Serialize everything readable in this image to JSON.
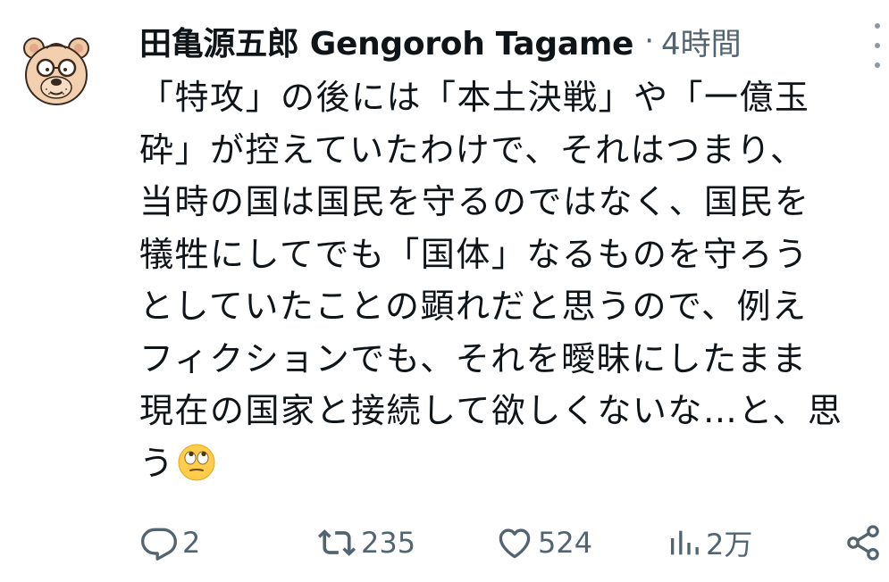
{
  "tweet": {
    "author": {
      "display_name": "田亀源五郎 Gengoroh Tagame",
      "separator": "·",
      "timestamp": "4時間"
    },
    "text_lines": [
      "「特攻」の後には「本土決戦」や「一億玉",
      "砕」が控えていたわけで、それはつまり、",
      "当時の国は国民を守るのではなく、国民を",
      "犠牲にしてでも「国体」なるものを守ろう",
      "としていたことの顕れだと思うので、例え",
      "フィクションでも、それを曖昧にしたまま",
      "現在の国家と接続して欲しくないな…と、思",
      "う"
    ],
    "actions": {
      "reply_count": "2",
      "retweet_count": "235",
      "like_count": "524",
      "views_count": "2万"
    }
  },
  "icons": {
    "avatar": "cartoon-bear-avatar",
    "emoji": "face-with-rolling-eyes-emoji",
    "more": "more-vertical-icon",
    "reply": "reply-icon",
    "retweet": "retweet-icon",
    "like": "heart-icon",
    "views": "views-icon",
    "share": "share-icon"
  },
  "colors": {
    "text_primary": "#0f1419",
    "text_secondary": "#536471",
    "background": "#ffffff"
  }
}
